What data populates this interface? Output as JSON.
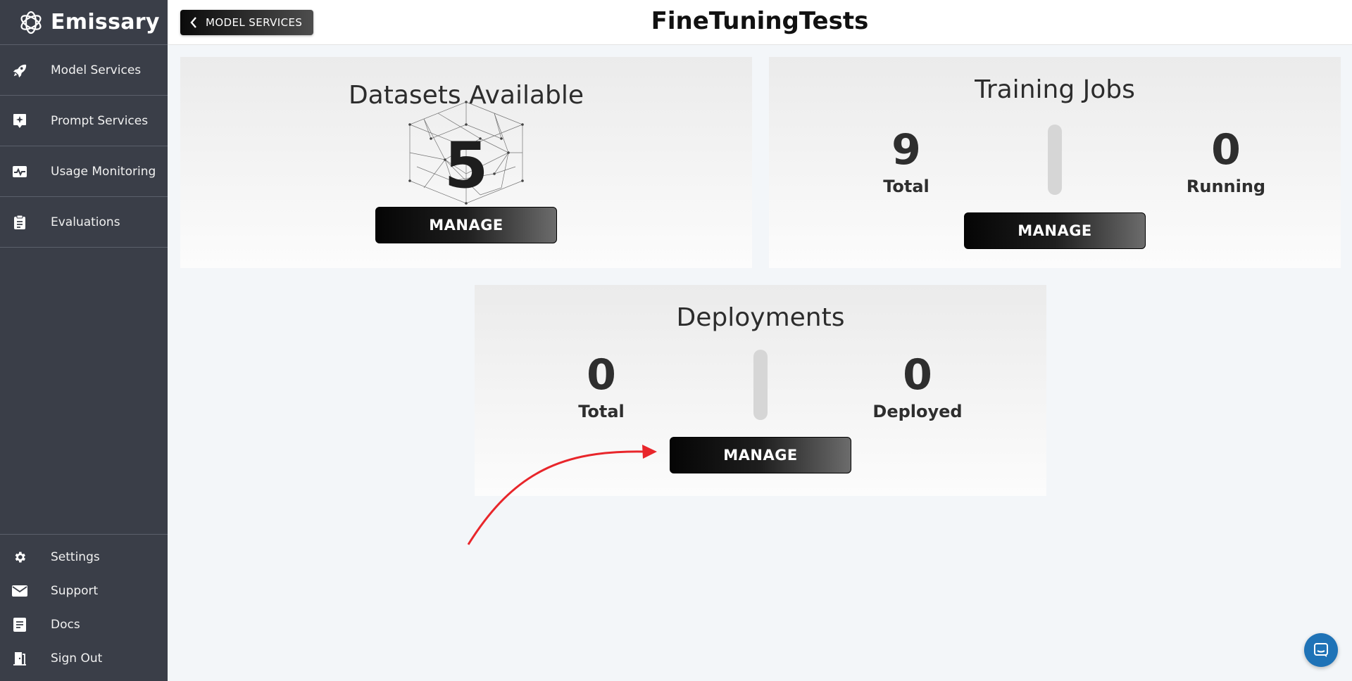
{
  "brand": {
    "name": "Emissary",
    "icon": "emissary-logo-icon"
  },
  "sidebar": {
    "items": [
      {
        "label": "Model Services",
        "icon": "rocket-icon"
      },
      {
        "label": "Prompt Services",
        "icon": "sparkle-chat-icon"
      },
      {
        "label": "Usage Monitoring",
        "icon": "pulse-monitor-icon"
      },
      {
        "label": "Evaluations",
        "icon": "clipboard-icon"
      }
    ],
    "bottom_items": [
      {
        "label": "Settings",
        "icon": "gear-icon"
      },
      {
        "label": "Support",
        "icon": "envelope-icon"
      },
      {
        "label": "Docs",
        "icon": "document-icon"
      },
      {
        "label": "Sign Out",
        "icon": "door-exit-icon"
      }
    ]
  },
  "header": {
    "back_label": "MODEL SERVICES",
    "title": "FineTuningTests"
  },
  "datasets": {
    "title": "Datasets Available",
    "count": "5",
    "manage_label": "MANAGE"
  },
  "training": {
    "title": "Training Jobs",
    "total_value": "9",
    "total_label": "Total",
    "running_value": "0",
    "running_label": "Running",
    "manage_label": "MANAGE"
  },
  "deployments": {
    "title": "Deployments",
    "total_value": "0",
    "total_label": "Total",
    "deployed_value": "0",
    "deployed_label": "Deployed",
    "manage_label": "MANAGE"
  },
  "colors": {
    "sidebar_bg": "#3a3e48",
    "page_bg": "#f3f6f9",
    "annotation_arrow": "#e8262b",
    "chat_button": "#1f73b7"
  },
  "chat": {
    "icon": "chat-bubble-icon"
  }
}
